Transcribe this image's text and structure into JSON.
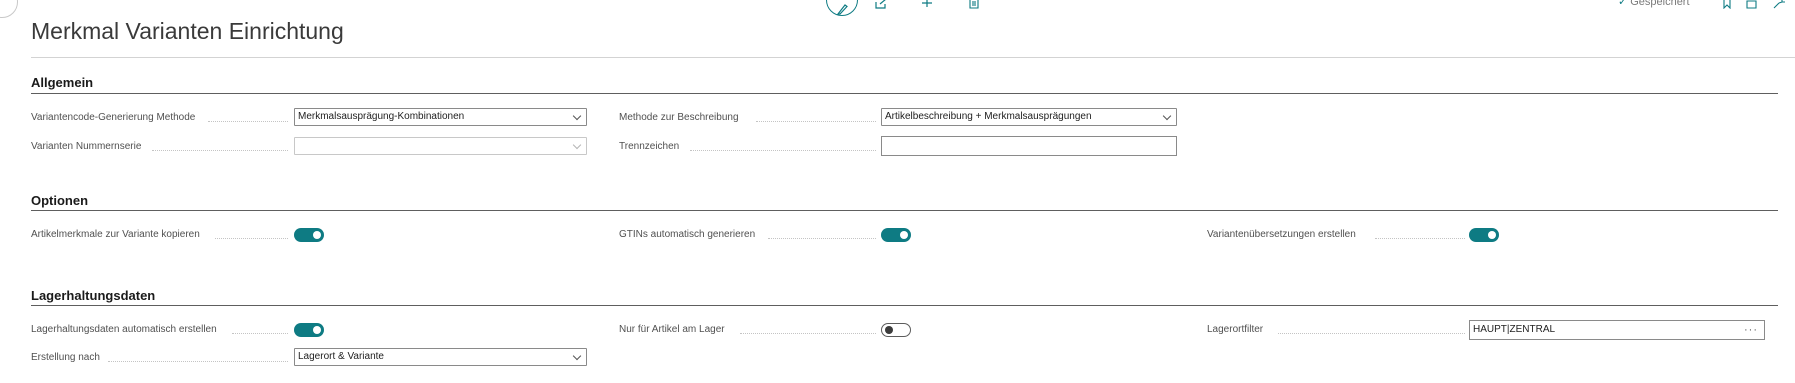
{
  "header": {
    "title": "Merkmal Varianten Einrichtung",
    "status": "Gespeichert"
  },
  "icons": {
    "back": "back-arrow-icon",
    "edit": "pencil-icon",
    "share": "share-icon",
    "new": "plus-icon",
    "delete": "trash-icon",
    "saved": "check-icon",
    "bookmark": "bookmark-icon",
    "open_new": "open-in-new-window-icon",
    "collapse": "collapse-icon"
  },
  "colors": {
    "accent": "#0e7b83"
  },
  "sections": {
    "allgemein": {
      "title": "Allgemein",
      "variant_code_method": {
        "label": "Variantencode-Generierung Methode",
        "value": "Merkmalsausprägung-Kombinationen"
      },
      "description_method": {
        "label": "Methode zur Beschreibung",
        "value": "Artikelbeschreibung + Merkmalsausprägungen"
      },
      "variant_no_series": {
        "label": "Varianten Nummernserie",
        "value": ""
      },
      "separator": {
        "label": "Trennzeichen",
        "value": ""
      }
    },
    "optionen": {
      "title": "Optionen",
      "copy_attributes": {
        "label": "Artikelmerkmale zur Variante kopieren",
        "on": true
      },
      "gtins": {
        "label": "GTINs automatisch generieren",
        "on": true
      },
      "translations": {
        "label": "Variantenübersetzungen erstellen",
        "on": true
      }
    },
    "lager": {
      "title": "Lagerhaltungsdaten",
      "auto_create": {
        "label": "Lagerhaltungsdaten automatisch erstellen",
        "on": true
      },
      "only_in_stock": {
        "label": "Nur für Artikel am Lager",
        "on": false
      },
      "location_filter": {
        "label": "Lagerortfilter",
        "value": "HAUPT|ZENTRAL"
      },
      "created_by": {
        "label": "Erstellung nach",
        "value": "Lagerort & Variante"
      }
    }
  }
}
